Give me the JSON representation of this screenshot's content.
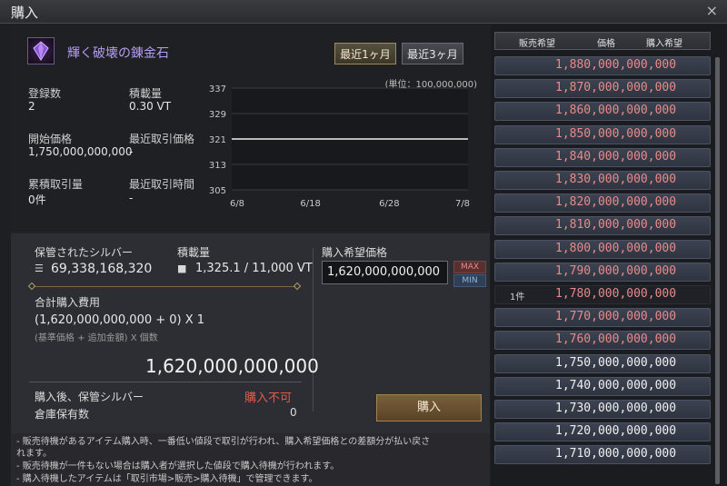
{
  "window": {
    "title": "購入",
    "close_glyph": "×"
  },
  "item": {
    "name": "輝く破壊の錬金石",
    "icon": "purple-crystal-icon"
  },
  "period_buttons": [
    "最近1ヶ月",
    "最近3ヶ月"
  ],
  "stats": {
    "registered_label": "登録数",
    "registered_value": "2",
    "load_label": "積載量",
    "load_value": "0.30 VT",
    "start_price_label": "開始価格",
    "start_price_value": "1,750,000,000,000",
    "recent_price_label": "最近取引価格",
    "recent_price_value": "-",
    "cumulative_label": "累積取引量",
    "cumulative_value": "0件",
    "recent_time_label": "最近取引時間",
    "recent_time_value": "-"
  },
  "chart": {
    "unit_label": "(単位：100,000,000)"
  },
  "chart_data": {
    "type": "line",
    "x": [
      "6/8",
      "6/18",
      "6/28",
      "7/8"
    ],
    "yticks": [
      337,
      329,
      321,
      313,
      305
    ],
    "ylim": [
      305,
      337
    ],
    "series": [
      {
        "values": [
          321,
          321
        ]
      }
    ],
    "grid": true
  },
  "purchase": {
    "stored_silver_label": "保管されたシルバー",
    "stored_silver_value": "69,338,168,320",
    "load_label": "積載量",
    "load_value": "1,325.1 / 11,000 VT",
    "desired_price_label": "購入希望価格",
    "desired_price_value": "1,620,000,000,000",
    "max_label": "MAX",
    "min_label": "MIN",
    "total_cost_label": "合計購入費用",
    "formula": "(1,620,000,000,000 + 0) X 1",
    "formula_note": "(基準価格 + 追加金額) X 個数",
    "total_value": "1,620,000,000,000",
    "after_silver_label": "購入後、保管シルバー",
    "after_silver_value": "購入不可",
    "warehouse_label": "倉庫保有数",
    "warehouse_value": "0",
    "buy_button": "購入"
  },
  "notes": [
    "- 販売待機があるアイテム購入時、一番低い値段で取引が行われ、購入希望価格との差額分が払い戻さ",
    "れます。",
    "- 販売待機が一件もない場合は購入者が選択した値段で購入待機が行われます。",
    "- 購入待機したアイテムは「取引市場>販売>購入待機」で管理できます。"
  ],
  "price_list": {
    "headers": [
      "販売希望",
      "価格",
      "購入希望"
    ],
    "rows": [
      {
        "price": "1,880,000,000,000",
        "color": "#e88a8a",
        "count": ""
      },
      {
        "price": "1,870,000,000,000",
        "color": "#e88a8a",
        "count": ""
      },
      {
        "price": "1,860,000,000,000",
        "color": "#e88a8a",
        "count": ""
      },
      {
        "price": "1,850,000,000,000",
        "color": "#e88a8a",
        "count": ""
      },
      {
        "price": "1,840,000,000,000",
        "color": "#e88a8a",
        "count": ""
      },
      {
        "price": "1,830,000,000,000",
        "color": "#e88a8a",
        "count": ""
      },
      {
        "price": "1,820,000,000,000",
        "color": "#e88a8a",
        "count": ""
      },
      {
        "price": "1,810,000,000,000",
        "color": "#e88a8a",
        "count": ""
      },
      {
        "price": "1,800,000,000,000",
        "color": "#e88a8a",
        "count": ""
      },
      {
        "price": "1,790,000,000,000",
        "color": "#e88a8a",
        "count": ""
      },
      {
        "price": "1,780,000,000,000",
        "color": "#e88a8a",
        "count": "1件"
      },
      {
        "price": "1,770,000,000,000",
        "color": "#e88a8a",
        "count": ""
      },
      {
        "price": "1,760,000,000,000",
        "color": "#e88a8a",
        "count": ""
      },
      {
        "price": "1,750,000,000,000",
        "color": "#f0f0f0",
        "count": ""
      },
      {
        "price": "1,740,000,000,000",
        "color": "#f0f0f0",
        "count": ""
      },
      {
        "price": "1,730,000,000,000",
        "color": "#f0f0f0",
        "count": ""
      },
      {
        "price": "1,720,000,000,000",
        "color": "#f0f0f0",
        "count": ""
      },
      {
        "price": "1,710,000,000,000",
        "color": "#f0f0f0",
        "count": ""
      }
    ]
  }
}
